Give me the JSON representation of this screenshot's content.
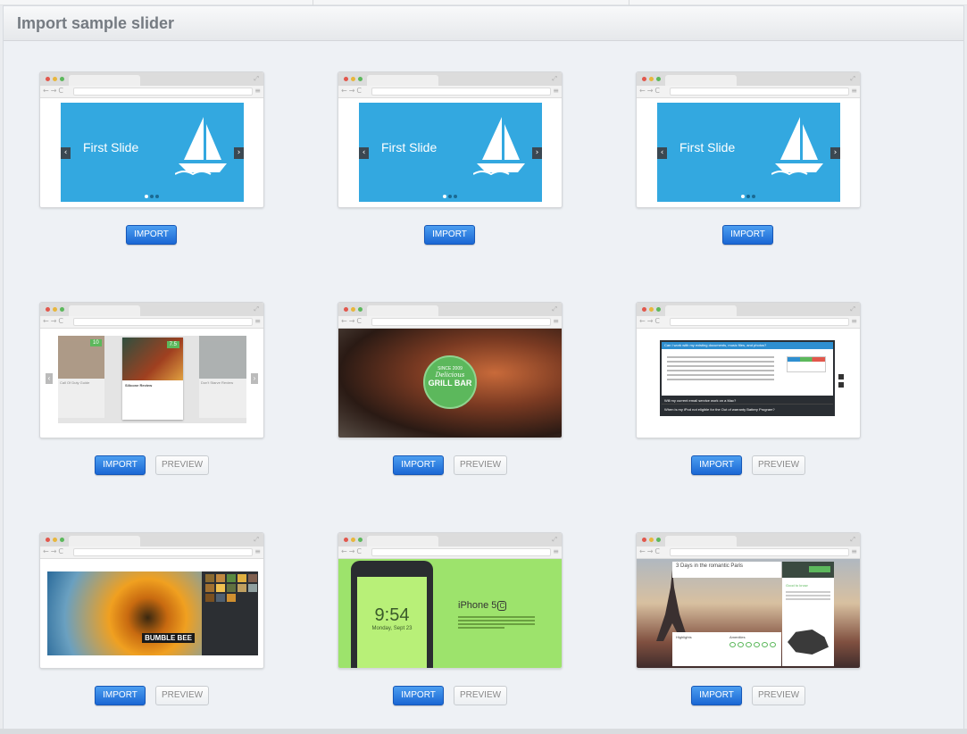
{
  "panel": {
    "title": "Import sample slider"
  },
  "buttons": {
    "import": "IMPORT",
    "preview": "PREVIEW"
  },
  "slides": {
    "first_slide": "First Slide",
    "grill": {
      "since": "SINCE 2009",
      "name": "GRILL BAR",
      "script": "Delicious"
    },
    "bumble": "BUMBLE BEE",
    "iphone": {
      "model": "iPhone 5",
      "badge": "C",
      "time": "9:54",
      "date": "Monday, Sept 23"
    },
    "paris": {
      "title": "3 Days in the romantic Paris",
      "highlights": "Highlights",
      "amenities": "Amenities",
      "good_to_know": "Good to know"
    },
    "reviews": [
      "Call Of Duty Guide",
      "Silicone Review",
      "Don't Starve Review"
    ],
    "faq": [
      "Can I work with my existing documents, music files, and photos?",
      "Will my current email service work on a Mac?",
      "When is my iPod not eligible for the Out of warranty Battery Program?"
    ]
  },
  "colors": {
    "import_blue": "#1a67d4",
    "slide_blue": "#33a8e0",
    "iphone_green": "#9de36c",
    "grill_green": "#5cb85c"
  }
}
